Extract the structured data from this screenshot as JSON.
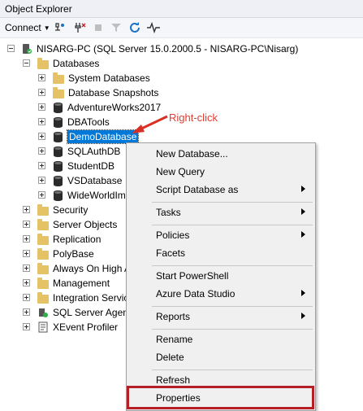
{
  "window": {
    "title": "Object Explorer"
  },
  "toolbar": {
    "connect_label": "Connect"
  },
  "tree": {
    "server": "NISARG-PC (SQL Server 15.0.2000.5 - NISARG-PC\\Nisarg)",
    "databases": "Databases",
    "system_databases": "System Databases",
    "database_snapshots": "Database Snapshots",
    "db_adventureworks": "AdventureWorks2017",
    "db_dbatools": "DBATools",
    "db_demo": "DemoDatabase",
    "db_sqlauth": "SQLAuthDB",
    "db_student": "StudentDB",
    "db_vs": "VSDatabase",
    "db_wwi": "WideWorldIm",
    "security": "Security",
    "server_objects": "Server Objects",
    "replication": "Replication",
    "polybase": "PolyBase",
    "always_on": "Always On High A",
    "management": "Management",
    "integration_services": "Integration Servic",
    "sql_agent": "SQL Server Agent",
    "xevent_profiler": "XEvent Profiler"
  },
  "annotation": {
    "text": "Right-click",
    "color": "#e03c31"
  },
  "context_menu": {
    "new_database": "New Database...",
    "new_query": "New Query",
    "script_database_as": "Script Database as",
    "tasks": "Tasks",
    "policies": "Policies",
    "facets": "Facets",
    "start_powershell": "Start PowerShell",
    "azure_data_studio": "Azure Data Studio",
    "reports": "Reports",
    "rename": "Rename",
    "delete": "Delete",
    "refresh": "Refresh",
    "properties": "Properties"
  },
  "colors": {
    "selection": "#0078d7",
    "highlight_box": "#b52026"
  }
}
